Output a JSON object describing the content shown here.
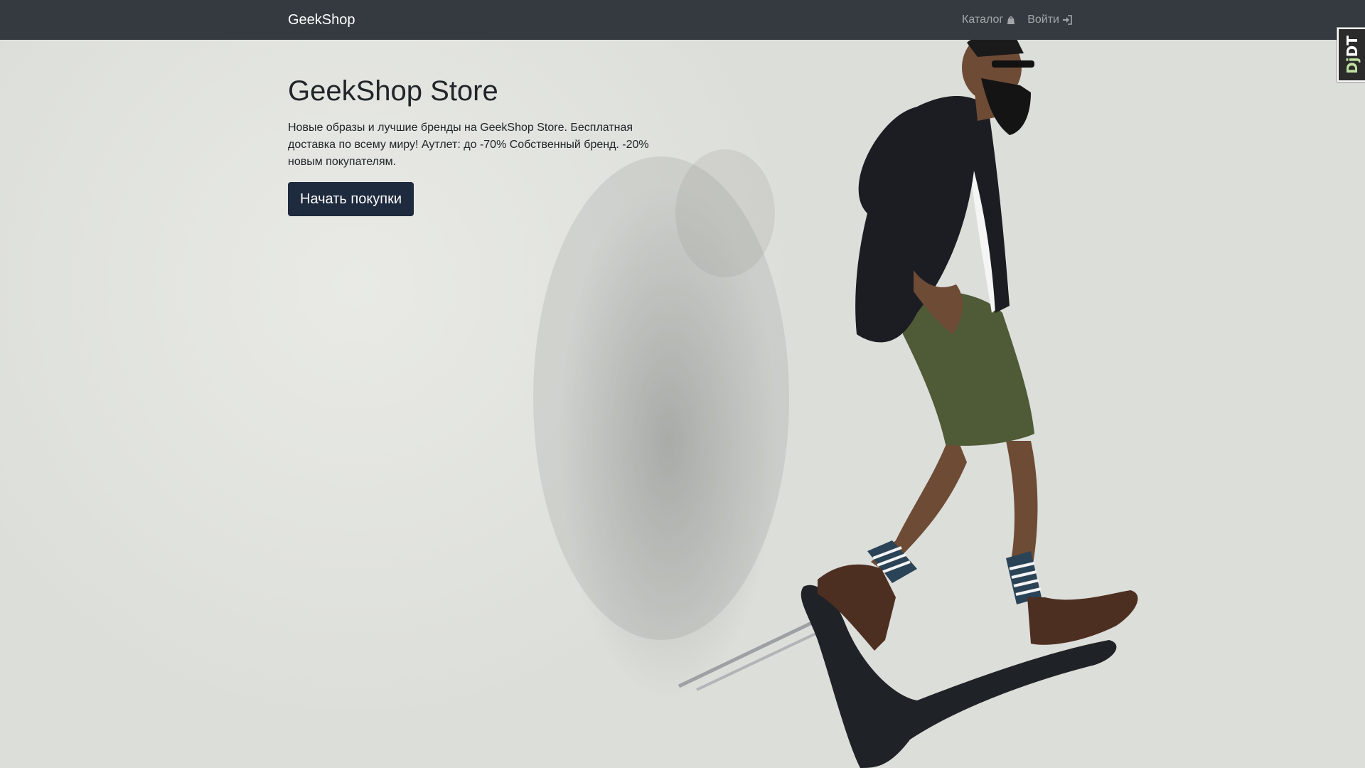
{
  "navbar": {
    "brand": "GeekShop",
    "links": [
      {
        "label": "Каталог",
        "icon": "shopping-bag-icon"
      },
      {
        "label": "Войти",
        "icon": "sign-in-icon"
      }
    ],
    "background": "#343a40"
  },
  "hero": {
    "title": "GeekShop Store",
    "text": "Новые образы и лучшие бренды на GeekShop Store. Бесплатная доставка по всему миру! Аутлет: до -70% Собственный бренд. -20% новым покупателям.",
    "button_label": "Начать покупки",
    "button_color": "#1e2a3e",
    "image": "man-on-chair-photo"
  },
  "debug_toolbar": {
    "label_dj": "Dj",
    "label_dt": "DT"
  }
}
